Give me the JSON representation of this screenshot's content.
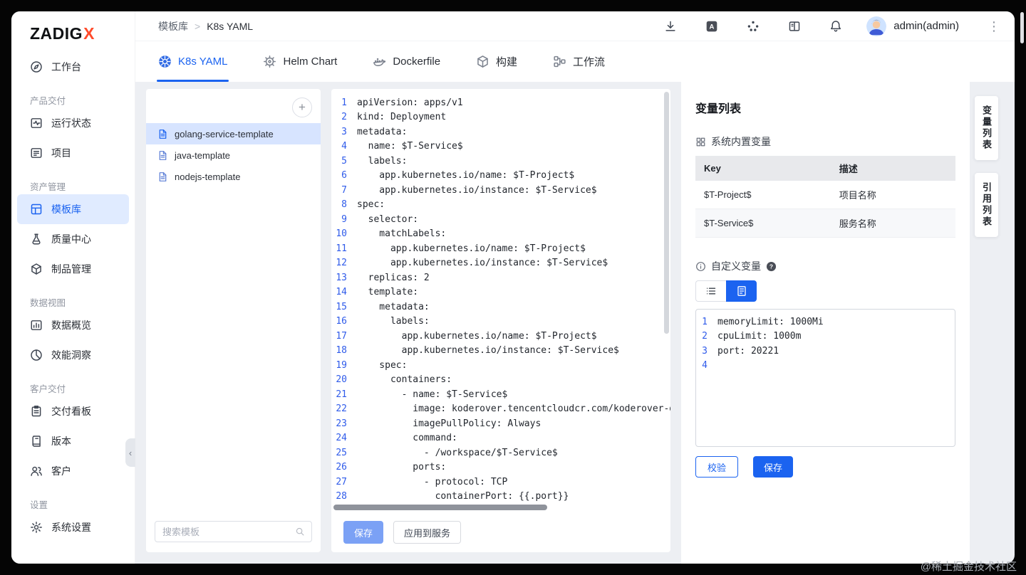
{
  "colors": {
    "accent": "#1b63f0",
    "accent_light": "#7ba1f5",
    "k8s_blue": "#326ce5",
    "selected_bg": "#d7e4ff"
  },
  "logo": {
    "name": "ZADIG",
    "x": "X"
  },
  "sidebar": {
    "workbench": "工作台",
    "sections": [
      {
        "label": "产品交付",
        "items": [
          {
            "label": "运行状态"
          },
          {
            "label": "项目"
          }
        ]
      },
      {
        "label": "资产管理",
        "items": [
          {
            "label": "模板库",
            "active": true
          },
          {
            "label": "质量中心"
          },
          {
            "label": "制品管理"
          }
        ]
      },
      {
        "label": "数据视图",
        "items": [
          {
            "label": "数据概览"
          },
          {
            "label": "效能洞察"
          }
        ]
      },
      {
        "label": "客户交付",
        "items": [
          {
            "label": "交付看板"
          },
          {
            "label": "版本"
          },
          {
            "label": "客户"
          }
        ]
      },
      {
        "label": "设置",
        "items": [
          {
            "label": "系统设置"
          }
        ]
      }
    ]
  },
  "header": {
    "breadcrumb_parent": "模板库",
    "breadcrumb_sep": ">",
    "breadcrumb_current": "K8s YAML",
    "user": "admin(admin)"
  },
  "tabs": [
    {
      "label": "K8s YAML",
      "active": true
    },
    {
      "label": "Helm Chart"
    },
    {
      "label": "Dockerfile"
    },
    {
      "label": "构建"
    },
    {
      "label": "工作流"
    }
  ],
  "template_list": {
    "search_placeholder": "搜索模板",
    "items": [
      {
        "name": "golang-service-template",
        "active": true
      },
      {
        "name": "java-template"
      },
      {
        "name": "nodejs-template"
      }
    ]
  },
  "editor": {
    "lines": [
      "apiVersion: apps/v1",
      "kind: Deployment",
      "metadata:",
      "  name: $T-Service$",
      "  labels:",
      "    app.kubernetes.io/name: $T-Project$",
      "    app.kubernetes.io/instance: $T-Service$",
      "spec:",
      "  selector:",
      "    matchLabels:",
      "      app.kubernetes.io/name: $T-Project$",
      "      app.kubernetes.io/instance: $T-Service$",
      "  replicas: 2",
      "  template:",
      "    metadata:",
      "      labels:",
      "        app.kubernetes.io/name: $T-Project$",
      "        app.kubernetes.io/instance: $T-Service$",
      "    spec:",
      "      containers:",
      "        - name: $T-Service$",
      "          image: koderover.tencentcloudcr.com/koderover-dem",
      "          imagePullPolicy: Always",
      "          command:",
      "            - /workspace/$T-Service$",
      "          ports:",
      "            - protocol: TCP",
      "              containerPort: {{.port}}"
    ],
    "save_label": "保存",
    "apply_label": "应用到服务"
  },
  "variables": {
    "title": "变量列表",
    "system": {
      "title": "系统内置变量",
      "col_key": "Key",
      "col_desc": "描述",
      "rows": [
        {
          "key": "$T-Project$",
          "desc": "项目名称"
        },
        {
          "key": "$T-Service$",
          "desc": "服务名称"
        }
      ]
    },
    "custom": {
      "title": "自定义变量",
      "lines": [
        "memoryLimit: 1000Mi",
        "cpuLimit: 1000m",
        "port: 20221",
        ""
      ],
      "validate_label": "校验",
      "save_label": "保存"
    }
  },
  "right_tabs": [
    {
      "label": "变量列表",
      "active": true
    },
    {
      "label": "引用列表"
    }
  ],
  "watermark": "@稀土掘金技术社区",
  "icons": {
    "sidebar": [
      "workbench-icon",
      "status-icon",
      "project-icon",
      "template-icon",
      "quality-icon",
      "artifact-icon",
      "data-icon",
      "insight-icon",
      "board-icon",
      "version-icon",
      "customer-icon",
      "settings-icon"
    ],
    "header": [
      "download-icon",
      "language-icon",
      "cluster-icon",
      "docs-icon",
      "bell-icon",
      "more-menu-icon"
    ],
    "tabs": [
      "k8s-icon",
      "helm-icon",
      "docker-icon",
      "build-icon",
      "workflow-icon"
    ],
    "misc": [
      "add-icon",
      "search-icon",
      "document-icon",
      "grid-icon",
      "info-icon",
      "help-icon",
      "list-view-icon",
      "editor-view-icon",
      "collapse-icon"
    ]
  }
}
